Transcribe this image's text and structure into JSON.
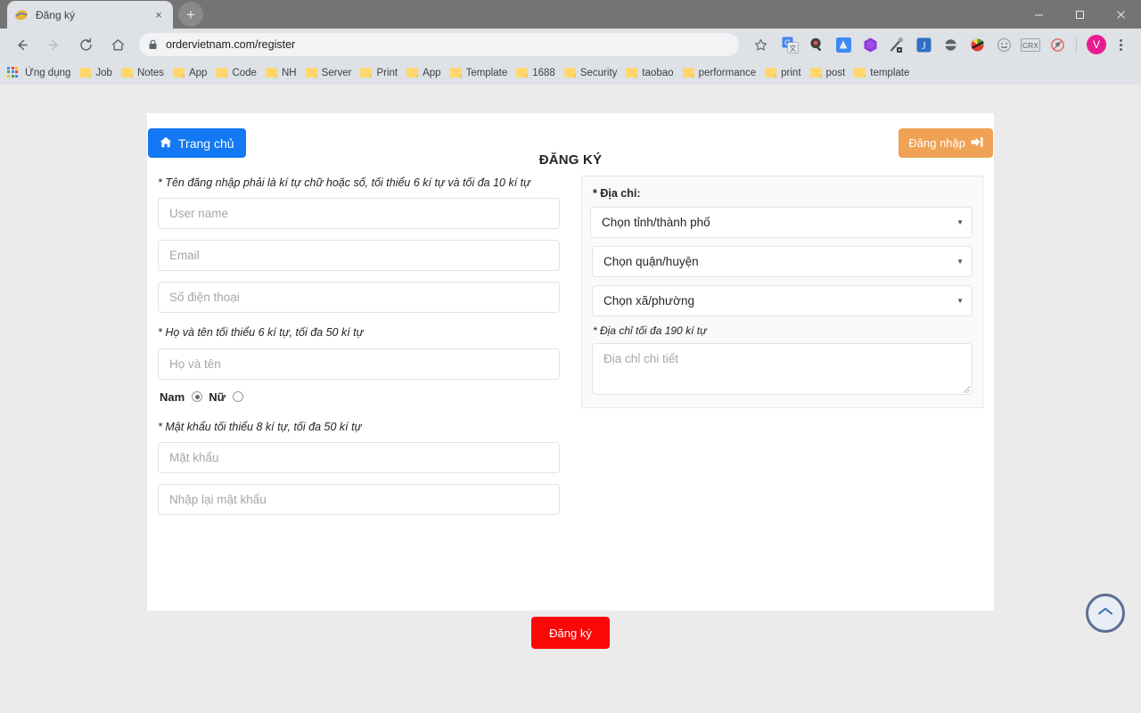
{
  "browser": {
    "tab": {
      "title": "Đăng ký",
      "favicon": "site-favicon",
      "close": "×"
    },
    "new_tab": "+",
    "window_controls": {
      "minimize": "—",
      "maximize": "▢",
      "close": "✕"
    },
    "nav": {
      "back": "←",
      "forward": "→",
      "reload": "⟳",
      "home": "⌂"
    },
    "omnibox": {
      "url": "ordervietnam.com/register",
      "lock": "lock-icon",
      "star": "☆"
    },
    "extensions": [
      "google-translate-icon",
      "search-extension-icon",
      "grammarly-icon",
      "purple-box-icon",
      "eyedropper-icon",
      "json-viewer-icon",
      "dark-reader-icon",
      "colorzilla-icon",
      "smiley-icon",
      "crx-icon",
      "adblock-icon"
    ],
    "crx_label": "CRX",
    "profile_initial": "V",
    "bookmarks": [
      {
        "label": "Ứng dụng",
        "icon": "apps-grid-icon"
      },
      {
        "label": "Job",
        "icon": "folder-icon"
      },
      {
        "label": "Notes",
        "icon": "folder-icon"
      },
      {
        "label": "App",
        "icon": "folder-icon"
      },
      {
        "label": "Code",
        "icon": "folder-icon"
      },
      {
        "label": "NH",
        "icon": "folder-icon"
      },
      {
        "label": "Server",
        "icon": "folder-icon"
      },
      {
        "label": "Print",
        "icon": "folder-icon"
      },
      {
        "label": "App",
        "icon": "folder-icon"
      },
      {
        "label": "Template",
        "icon": "folder-icon"
      },
      {
        "label": "1688",
        "icon": "folder-icon"
      },
      {
        "label": "Security",
        "icon": "folder-icon"
      },
      {
        "label": "taobao",
        "icon": "folder-icon"
      },
      {
        "label": "performance",
        "icon": "folder-icon"
      },
      {
        "label": "print",
        "icon": "folder-icon"
      },
      {
        "label": "post",
        "icon": "folder-icon"
      },
      {
        "label": "template",
        "icon": "folder-icon"
      }
    ]
  },
  "page": {
    "home_button": "Trang chủ",
    "login_button": "Đăng nhập",
    "title": "ĐĂNG KÝ",
    "submit_button": "Đăng ký",
    "scroll_top": "chevron-up-icon",
    "left": {
      "username_hint": "* Tên đăng nhập phải là kí tự chữ hoặc số, tối thiểu 6 kí tự và tối đa 10 kí tự",
      "username_placeholder": "User name",
      "username_value": "",
      "email_placeholder": "Email",
      "email_value": "",
      "phone_placeholder": "Số điện thoại",
      "phone_value": "",
      "fullname_hint": "* Họ và tên tối thiểu 6 kí tự, tối đa 50 kí tự",
      "fullname_placeholder": "Họ và tên",
      "fullname_value": "",
      "gender_male": "Nam",
      "gender_female": "Nữ",
      "gender_selected": "Nam",
      "password_hint": "* Mật khẩu tối thiểu 8 kí tự, tối đa 50 kí tự",
      "password_placeholder": "Mật khẩu",
      "password_value": "",
      "password_confirm_placeholder": "Nhập lại mật khẩu",
      "password_confirm_value": ""
    },
    "right": {
      "address_label": "* Địa chỉ:",
      "province_selected": "Chọn tỉnh/thành phố",
      "district_selected": "Chọn quận/huyện",
      "ward_selected": "Chọn xã/phường",
      "detail_hint": "* Địa chỉ tối đa 190 kí tự",
      "detail_placeholder": "Địa chỉ chi tiết",
      "detail_value": ""
    }
  },
  "colors": {
    "primary_blue": "#1278f3",
    "login_orange": "#f0a254",
    "submit_red": "#fa0707",
    "page_bg": "#ebebeb",
    "card_bg": "#ffffff"
  }
}
